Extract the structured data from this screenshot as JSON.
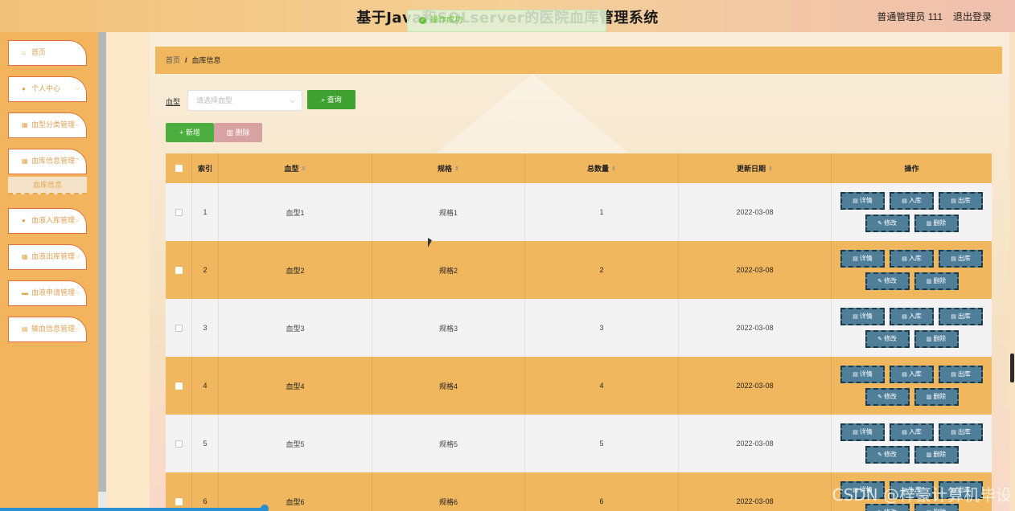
{
  "header": {
    "title": "基于Java和SQLserver的医院血库管理系统",
    "toast": "操作成功",
    "user": "普通管理员 111",
    "logout": "退出登录"
  },
  "sidebar": {
    "items": [
      {
        "label": "首页",
        "icon": "home-icon"
      },
      {
        "label": "个人中心",
        "icon": "user-icon"
      },
      {
        "label": "血型分类管理",
        "icon": "grid-icon"
      },
      {
        "label": "血库信息管理",
        "icon": "grid-icon"
      },
      {
        "label": "血液入库管理",
        "icon": "user-icon"
      },
      {
        "label": "血液出库管理",
        "icon": "grid-icon"
      },
      {
        "label": "血液申请管理",
        "icon": "bank-icon"
      },
      {
        "label": "输血信息管理",
        "icon": "doc-icon"
      }
    ],
    "active_sub": "血库信息"
  },
  "breadcrumb": {
    "home": "首页",
    "sep": "/",
    "current": "血库信息"
  },
  "filter": {
    "label": "血型",
    "placeholder": "请选择血型",
    "query_button": "查询"
  },
  "actions": {
    "add": "新增",
    "delete": "删除"
  },
  "table": {
    "headers": [
      "索引",
      "血型",
      "规格",
      "总数量",
      "更新日期",
      "操作"
    ],
    "rows": [
      {
        "index": "1",
        "blood_type": "血型1",
        "spec": "规格1",
        "total": "1",
        "date": "2022-03-08"
      },
      {
        "index": "2",
        "blood_type": "血型2",
        "spec": "规格2",
        "total": "2",
        "date": "2022-03-08"
      },
      {
        "index": "3",
        "blood_type": "血型3",
        "spec": "规格3",
        "total": "3",
        "date": "2022-03-08"
      },
      {
        "index": "4",
        "blood_type": "血型4",
        "spec": "规格4",
        "total": "4",
        "date": "2022-03-08"
      },
      {
        "index": "5",
        "blood_type": "血型5",
        "spec": "规格5",
        "total": "5",
        "date": "2022-03-08"
      },
      {
        "index": "6",
        "blood_type": "血型6",
        "spec": "规格6",
        "total": "6",
        "date": "2022-03-08"
      }
    ],
    "ops": {
      "detail": "详情",
      "in": "入库",
      "out": "出库",
      "edit": "修改",
      "delete": "删除"
    }
  },
  "watermark": "CSDN @梓豪计算机毕设",
  "colors": {
    "accent": "#f0b75f",
    "menu_border": "#e0703c",
    "success": "#3ea130",
    "op_button": "#4f7f98"
  }
}
